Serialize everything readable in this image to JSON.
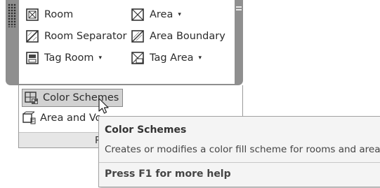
{
  "ribbon": {
    "tools": [
      {
        "label": "Room",
        "icon": "room-icon"
      },
      {
        "label": "Area",
        "icon": "area-icon",
        "caret": "▾"
      },
      {
        "label": "Room Separator",
        "icon": "room-separator-icon"
      },
      {
        "label": "Area Boundary",
        "icon": "area-boundary-icon"
      },
      {
        "label": "Tag Room",
        "icon": "tag-room-icon",
        "caret": "▾"
      },
      {
        "label": "Tag Area",
        "icon": "tag-area-icon",
        "caret": "▾"
      }
    ]
  },
  "dropdown": {
    "items": [
      {
        "label": "Color Schemes",
        "icon": "color-schemes-icon",
        "highlighted": true
      },
      {
        "label": "Area and Vo",
        "icon": "area-volume-computations-icon"
      }
    ],
    "footer_label": "Ro"
  },
  "tooltip": {
    "title": "Color Schemes",
    "description": "Creates or modifies a color fill scheme for rooms and areas.",
    "help": "Press F1 for more help"
  },
  "colors": {
    "panel_gray": "#8f8f8f",
    "highlight": "#d2d2d2",
    "tooltip_bg": "#f4f4f4"
  }
}
